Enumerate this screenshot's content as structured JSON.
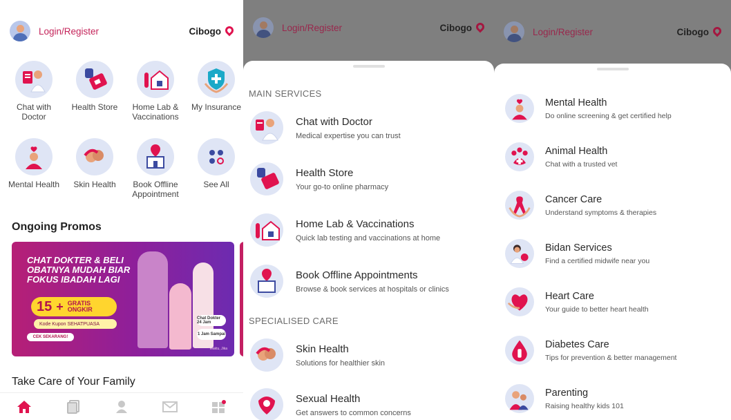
{
  "header": {
    "login_label": "Login/Register",
    "location": "Cibogo"
  },
  "home": {
    "grid": [
      {
        "label": "Chat with Doctor",
        "icon": "doctor-icon"
      },
      {
        "label": "Health Store",
        "icon": "pill-box-icon"
      },
      {
        "label": "Home Lab & Vaccinations",
        "icon": "home-lab-icon"
      },
      {
        "label": "My Insurance",
        "icon": "insurance-shield-icon"
      },
      {
        "label": "Mental Health",
        "icon": "mental-health-icon"
      },
      {
        "label": "Skin Health",
        "icon": "skin-health-icon"
      },
      {
        "label": "Book Offline Appointment",
        "icon": "hospital-pin-icon"
      },
      {
        "label": "See All",
        "icon": "see-all-dots-icon"
      }
    ],
    "promos_title": "Ongoing Promos",
    "banner": {
      "headline": "CHAT DOKTER & BELI OBATNYA MUDAH BIAR FOKUS IBADAH LAGI",
      "pill_small": "CHAT DOKTER POTONGAN",
      "pill_big": "15",
      "pill_plus": "+",
      "pill_gratis": "GRATIS ONGKIR",
      "code": "Kode Kupon  SEHATPUASA",
      "cta": "CEK SEKARANG!",
      "badge1": "Chat Dokter 24 Jam",
      "badge2": "1 Jam Sampai",
      "fine": "*Waktu, Jika"
    },
    "family_title": "Take Care of Your Family",
    "nav": [
      {
        "icon": "home-icon",
        "active": true
      },
      {
        "icon": "records-icon",
        "active": false
      },
      {
        "icon": "profile-icon",
        "active": false
      },
      {
        "icon": "inbox-icon",
        "active": false
      },
      {
        "icon": "apps-icon",
        "active": false
      }
    ]
  },
  "services_sheet": {
    "main_title": "MAIN SERVICES",
    "main": [
      {
        "title": "Chat with Doctor",
        "desc": "Medical expertise you can trust"
      },
      {
        "title": "Health Store",
        "desc": "Your go-to online pharmacy"
      },
      {
        "title": "Home Lab & Vaccinations",
        "desc": "Quick lab testing and vaccinations at home"
      },
      {
        "title": "Book Offline Appointments",
        "desc": "Browse & book services at hospitals or clinics"
      }
    ],
    "special_title": "SPECIALISED CARE",
    "special": [
      {
        "title": "Skin Health",
        "desc": "Solutions for healthier skin"
      },
      {
        "title": "Sexual Health",
        "desc": "Get answers to common concerns"
      }
    ]
  },
  "specialised_sheet": {
    "items": [
      {
        "title": "Mental Health",
        "desc": "Do online screening & get certified help"
      },
      {
        "title": "Animal Health",
        "desc": "Chat with a trusted vet"
      },
      {
        "title": "Cancer Care",
        "desc": "Understand symptoms & therapies"
      },
      {
        "title": "Bidan Services",
        "desc": "Find a certified midwife near you"
      },
      {
        "title": "Heart Care",
        "desc": "Your guide to better heart health"
      },
      {
        "title": "Diabetes Care",
        "desc": "Tips for prevention & better management"
      },
      {
        "title": "Parenting",
        "desc": "Raising healthy kids 101"
      }
    ]
  },
  "colors": {
    "brand": "#e0134f",
    "link": "#c4245a",
    "icon_bg": "#dfe5f5"
  }
}
